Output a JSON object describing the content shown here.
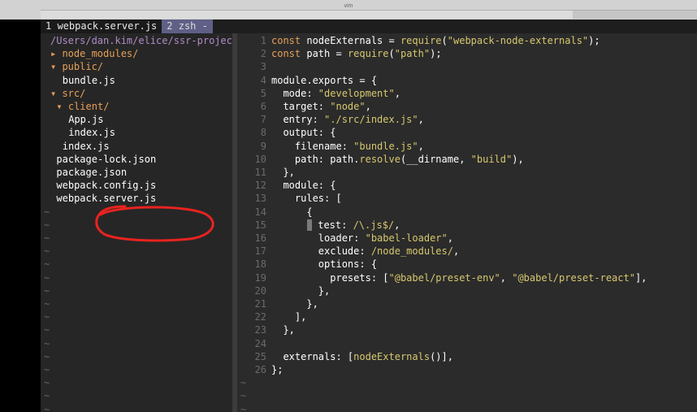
{
  "window": {
    "title": "vim"
  },
  "tabs": [
    {
      "label": "1 webpack.server.js"
    },
    {
      "label": "2 zsh -"
    }
  ],
  "tree": {
    "root": "/Users/dan.kim/elice/ssr-project/",
    "items": [
      {
        "indent": 0,
        "arrow": "▸",
        "label": "node_modules/",
        "type": "dir"
      },
      {
        "indent": 0,
        "arrow": "▾",
        "label": "public/",
        "type": "dir"
      },
      {
        "indent": 2,
        "arrow": "",
        "label": "bundle.js",
        "type": "file"
      },
      {
        "indent": 0,
        "arrow": "▾",
        "label": "src/",
        "type": "dir"
      },
      {
        "indent": 1,
        "arrow": "▾",
        "label": "client/",
        "type": "dir"
      },
      {
        "indent": 3,
        "arrow": "",
        "label": "App.js",
        "type": "file"
      },
      {
        "indent": 3,
        "arrow": "",
        "label": "index.js",
        "type": "file"
      },
      {
        "indent": 2,
        "arrow": "",
        "label": "index.js",
        "type": "file"
      },
      {
        "indent": 1,
        "arrow": "",
        "label": "package-lock.json",
        "type": "file"
      },
      {
        "indent": 1,
        "arrow": "",
        "label": "package.json",
        "type": "file"
      },
      {
        "indent": 1,
        "arrow": "",
        "label": "webpack.config.js",
        "type": "file"
      },
      {
        "indent": 1,
        "arrow": "",
        "label": "webpack.server.js",
        "type": "file"
      }
    ]
  },
  "code": {
    "lines": [
      {
        "n": "1",
        "tokens": [
          [
            "kw",
            "const "
          ],
          [
            "id",
            "nodeExternals = "
          ],
          [
            "fn",
            "require"
          ],
          [
            "pun",
            "("
          ],
          [
            "str",
            "\"webpack-node-externals\""
          ],
          [
            "pun",
            ");"
          ]
        ]
      },
      {
        "n": "2",
        "tokens": [
          [
            "kw",
            "const "
          ],
          [
            "id",
            "path = "
          ],
          [
            "fn",
            "require"
          ],
          [
            "pun",
            "("
          ],
          [
            "str",
            "\"path\""
          ],
          [
            "pun",
            ");"
          ]
        ]
      },
      {
        "n": "3",
        "tokens": []
      },
      {
        "n": "4",
        "tokens": [
          [
            "id",
            "module.exports = {"
          ]
        ]
      },
      {
        "n": "5",
        "tokens": [
          [
            "id",
            "  mode: "
          ],
          [
            "str",
            "\"development\""
          ],
          [
            "pun",
            ","
          ]
        ]
      },
      {
        "n": "6",
        "tokens": [
          [
            "id",
            "  target: "
          ],
          [
            "str",
            "\"node\""
          ],
          [
            "pun",
            ","
          ]
        ]
      },
      {
        "n": "7",
        "tokens": [
          [
            "id",
            "  entry: "
          ],
          [
            "str",
            "\"./src/index.js\""
          ],
          [
            "pun",
            ","
          ]
        ]
      },
      {
        "n": "8",
        "tokens": [
          [
            "id",
            "  output: {"
          ]
        ]
      },
      {
        "n": "9",
        "tokens": [
          [
            "id",
            "    filename: "
          ],
          [
            "str",
            "\"bundle.js\""
          ],
          [
            "pun",
            ","
          ]
        ]
      },
      {
        "n": "10",
        "tokens": [
          [
            "id",
            "    path: path."
          ],
          [
            "fn",
            "resolve"
          ],
          [
            "pun",
            "(__dirname, "
          ],
          [
            "str",
            "\"build\""
          ],
          [
            "pun",
            "),"
          ]
        ]
      },
      {
        "n": "11",
        "tokens": [
          [
            "id",
            "  },"
          ]
        ]
      },
      {
        "n": "12",
        "tokens": [
          [
            "id",
            "  module: {"
          ]
        ]
      },
      {
        "n": "13",
        "tokens": [
          [
            "id",
            "    rules: ["
          ]
        ]
      },
      {
        "n": "14",
        "tokens": [
          [
            "id",
            "      {"
          ]
        ]
      },
      {
        "n": "15",
        "tokens": [
          [
            "cursor",
            ""
          ],
          [
            "id",
            " test: "
          ],
          [
            "rx",
            "/\\.js$/"
          ],
          [
            "pun",
            ","
          ]
        ]
      },
      {
        "n": "16",
        "tokens": [
          [
            "id",
            "        loader: "
          ],
          [
            "str",
            "\"babel-loader\""
          ],
          [
            "pun",
            ","
          ]
        ]
      },
      {
        "n": "17",
        "tokens": [
          [
            "id",
            "        exclude: "
          ],
          [
            "rx",
            "/node_modules/"
          ],
          [
            "pun",
            ","
          ]
        ]
      },
      {
        "n": "18",
        "tokens": [
          [
            "id",
            "        options: {"
          ]
        ]
      },
      {
        "n": "19",
        "tokens": [
          [
            "id",
            "          presets: ["
          ],
          [
            "str",
            "\"@babel/preset-env\""
          ],
          [
            "pun",
            ", "
          ],
          [
            "str",
            "\"@babel/preset-react\""
          ],
          [
            "pun",
            "],"
          ]
        ]
      },
      {
        "n": "20",
        "tokens": [
          [
            "id",
            "        },"
          ]
        ]
      },
      {
        "n": "21",
        "tokens": [
          [
            "id",
            "      },"
          ]
        ]
      },
      {
        "n": "22",
        "tokens": [
          [
            "id",
            "    ],"
          ]
        ]
      },
      {
        "n": "23",
        "tokens": [
          [
            "id",
            "  },"
          ]
        ]
      },
      {
        "n": "24",
        "tokens": []
      },
      {
        "n": "25",
        "tokens": [
          [
            "id",
            "  externals: ["
          ],
          [
            "fn",
            "nodeExternals"
          ],
          [
            "pun",
            "()],"
          ]
        ]
      },
      {
        "n": "26",
        "tokens": [
          [
            "id",
            "};"
          ]
        ]
      }
    ]
  },
  "empty_line_marker": "~",
  "colors": {
    "keyword": "#e8a058",
    "string": "#d7c86e",
    "directory": "#e8a058",
    "annotation": "#e8231f"
  }
}
